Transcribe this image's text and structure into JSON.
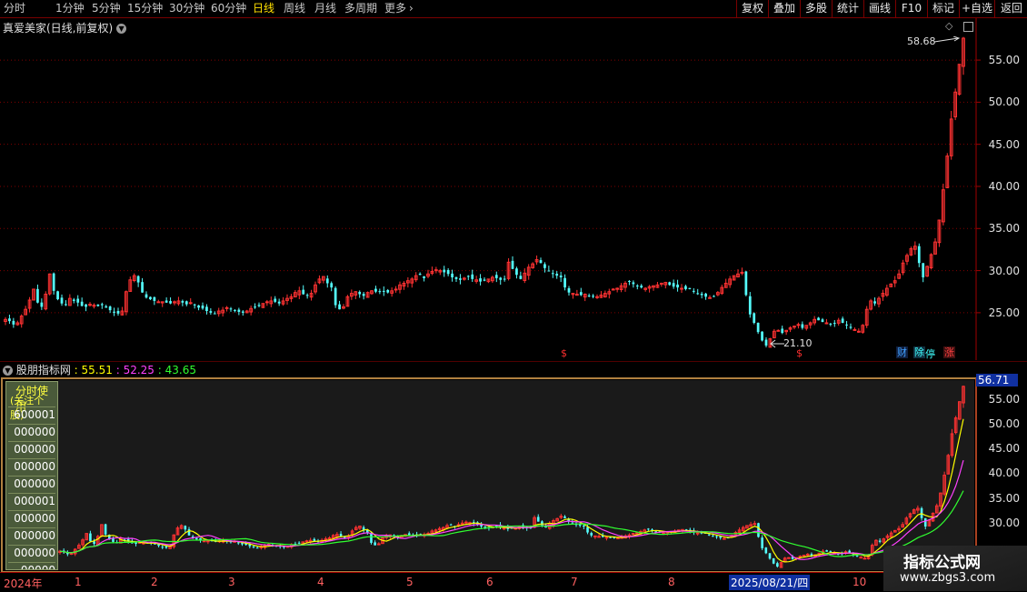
{
  "toolbar": {
    "periods": [
      "分时",
      "1分钟",
      "5分钟",
      "15分钟",
      "30分钟",
      "60分钟",
      "日线",
      "周线",
      "月线",
      "多周期",
      "更多"
    ],
    "active_period": "日线",
    "right_buttons": [
      "复权",
      "叠加",
      "多股",
      "统计",
      "画线",
      "F10",
      "标记",
      "+自选",
      "返回"
    ]
  },
  "price_panel": {
    "stock_title": "真爱美家(日线,前复权)",
    "high_label": "58.68",
    "low_label": "21.10",
    "y_ticks": [
      "55.00",
      "50.00",
      "45.00",
      "40.00",
      "35.00",
      "30.00",
      "25.00"
    ],
    "event_flags": [
      "财",
      "除",
      "涨"
    ]
  },
  "indicator_panel": {
    "name": "股朋指标网",
    "values": [
      "55.51",
      "52.25",
      "43.65"
    ],
    "colors": [
      "#ffff00",
      "#ff40ff",
      "#30ff30"
    ],
    "right_label": "56.71",
    "y_ticks": [
      "55.00",
      "50.00",
      "45.00",
      "40.00",
      "35.00",
      "30.00"
    ],
    "legend_title": "分时使用",
    "legend_subtitle": "(关注个股)",
    "legend_codes": [
      "600001",
      "000000",
      "000000",
      "000000",
      "000000",
      "000001",
      "000000",
      "000000",
      "000000",
      "00000"
    ]
  },
  "time_axis": {
    "year": "2024年",
    "months": [
      "1",
      "2",
      "3",
      "4",
      "5",
      "6",
      "7",
      "8",
      "10"
    ],
    "cursor_date": "2025/08/21/四"
  },
  "watermark": {
    "title": "指标公式网",
    "url": "www.zbgs3.com"
  },
  "chart_data": {
    "type": "candlestick",
    "ylim": [
      20,
      60
    ],
    "closes": [
      24.2,
      24.0,
      23.6,
      23.8,
      24.6,
      25.4,
      26.5,
      27.8,
      26.2,
      25.7,
      27.2,
      29.6,
      27.6,
      26.6,
      26.1,
      25.9,
      26.7,
      26.4,
      26.2,
      25.8,
      25.7,
      26.0,
      25.9,
      25.8,
      25.9,
      25.6,
      25.3,
      25.0,
      24.9,
      25.2,
      27.5,
      28.9,
      29.4,
      28.6,
      27.4,
      26.8,
      26.6,
      26.4,
      26.3,
      26.3,
      26.2,
      26.1,
      26.3,
      26.4,
      26.2,
      26.0,
      26.2,
      25.9,
      25.6,
      25.5,
      25.2,
      25.0,
      24.9,
      25.2,
      25.3,
      25.6,
      25.4,
      25.3,
      25.1,
      25.0,
      25.2,
      25.5,
      25.7,
      25.8,
      26.1,
      26.3,
      26.4,
      26.3,
      26.1,
      26.4,
      26.7,
      26.9,
      27.4,
      27.6,
      27.2,
      27.0,
      27.3,
      28.3,
      29.0,
      29.3,
      28.5,
      28.0,
      25.9,
      25.4,
      25.7,
      26.9,
      27.3,
      27.5,
      27.2,
      27.0,
      27.4,
      27.6,
      27.5,
      27.5,
      27.5,
      27.4,
      27.6,
      27.8,
      28.3,
      28.5,
      28.8,
      29.0,
      29.4,
      29.5,
      29.1,
      29.6,
      29.9,
      30.1,
      30.0,
      29.8,
      29.6,
      29.2,
      29.0,
      28.9,
      29.1,
      29.3,
      29.0,
      28.9,
      28.7,
      28.8,
      29.0,
      29.2,
      29.1,
      28.9,
      29.0,
      31.0,
      30.2,
      29.5,
      29.0,
      29.7,
      30.4,
      30.8,
      31.3,
      30.9,
      30.3,
      30.0,
      29.6,
      29.4,
      29.2,
      28.0,
      27.4,
      27.3,
      27.2,
      27.1,
      27.2,
      27.0,
      26.9,
      26.9,
      27.1,
      27.3,
      27.5,
      27.8,
      27.9,
      28.2,
      28.5,
      28.7,
      28.4,
      28.2,
      28.0,
      27.9,
      28.1,
      28.2,
      28.3,
      28.5,
      28.6,
      28.3,
      28.1,
      28.0,
      27.9,
      27.8,
      27.8,
      27.5,
      27.3,
      27.1,
      26.9,
      26.8,
      26.9,
      27.4,
      28.0,
      28.5,
      29.0,
      29.4,
      29.6,
      29.8,
      27.1,
      24.8,
      23.8,
      22.7,
      21.7,
      21.1,
      21.9,
      22.8,
      22.9,
      22.6,
      22.9,
      23.2,
      23.4,
      23.6,
      23.2,
      23.5,
      23.8,
      24.2,
      24.1,
      23.9,
      23.8,
      23.6,
      23.7,
      24.1,
      23.8,
      23.5,
      23.2,
      23.0,
      22.8,
      23.5,
      25.4,
      26.4,
      26.1,
      26.7,
      27.3,
      27.9,
      28.4,
      28.8,
      29.6,
      30.9,
      31.8,
      32.6,
      32.9,
      30.9,
      29.2,
      30.5,
      31.9,
      33.4,
      36.0,
      39.6,
      43.6,
      48.0,
      51.2,
      54.5,
      57.6
    ],
    "ma": [
      {
        "name": "",
        "color": "#ffff00",
        "window": 5
      },
      {
        "name": "",
        "color": "#ff40ff",
        "window": 10
      },
      {
        "name": "",
        "color": "#30ff30",
        "window": 20
      }
    ]
  }
}
